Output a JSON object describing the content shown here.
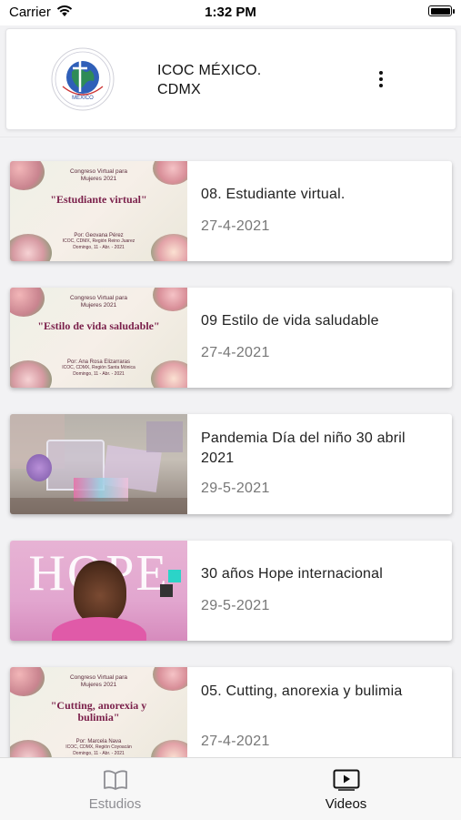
{
  "status_bar": {
    "carrier": "Carrier",
    "time": "1:32 PM"
  },
  "header": {
    "title_line1": "ICOC MÉXICO.",
    "title_line2": "CDMX",
    "logo_icon": "church-globe-logo",
    "menu_icon": "more-vertical-icon"
  },
  "videos": [
    {
      "title": "08.  Estudiante virtual.",
      "date": "27-4-2021",
      "thumb": {
        "style": "floral",
        "line1": "Congreso Virtual para",
        "line2": "Mujeres 2021",
        "headline": "\"Estudiante virtual\"",
        "speaker": "Por: Geovana Pérez",
        "details1": "ICOC, CDMX, Región Reino Juarez",
        "details2": "Domingo, 11 - Abr. - 2021"
      }
    },
    {
      "title": "09  Estilo de vida saludable",
      "date": "27-4-2021",
      "thumb": {
        "style": "floral",
        "line1": "Congreso Virtual para",
        "line2": "Mujeres 2021",
        "headline": "\"Estilo de vida saludable\"",
        "speaker": "Por: Ana Rosa Elizarraras",
        "details1": "ICOC, CDMX, Región Santa Mónica",
        "details2": "Domingo, 11 - Abr. - 2021"
      }
    },
    {
      "title": "Pandemia Día del niño 30 abril 2021",
      "date": "29-5-2021",
      "thumb": {
        "style": "photo-gifts"
      }
    },
    {
      "title": "30 años Hope internacional",
      "date": "29-5-2021",
      "thumb": {
        "style": "hope",
        "headline": "HOPE"
      }
    },
    {
      "title": "05. Cutting, anorexia y bulimia",
      "date": "27-4-2021",
      "thumb": {
        "style": "floral",
        "line1": "Congreso Virtual para",
        "line2": "Mujeres 2021",
        "headline": "\"Cutting, anorexia y bulimia\"",
        "speaker": "Por: Marcela Nava",
        "details1": "ICOC, CDMX, Región Coyoacán",
        "details2": "Domingo, 11 - Abr. - 2021"
      }
    }
  ],
  "tabs": [
    {
      "label": "Estudios",
      "icon": "book-icon",
      "active": false
    },
    {
      "label": "Videos",
      "icon": "play-video-icon",
      "active": true
    }
  ],
  "colors": {
    "headline_text": "#7a1f4a",
    "hope_bg": "#e2a6cf",
    "hope_accent": "#2bd4c8",
    "tab_active": "#111111",
    "tab_inactive": "#8e8e93",
    "date_text": "#777777"
  }
}
